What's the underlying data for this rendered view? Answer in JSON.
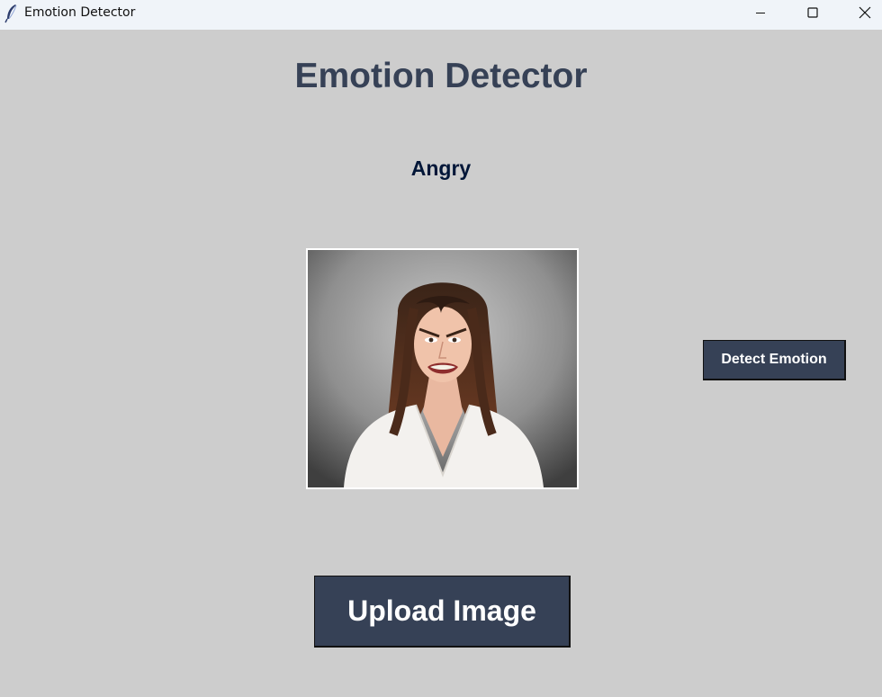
{
  "window": {
    "title": "Emotion Detector",
    "app_icon": "feather-icon",
    "controls": [
      "minimize-icon",
      "maximize-icon",
      "close-icon"
    ]
  },
  "main": {
    "heading": "Emotion Detector",
    "result_label": "Angry",
    "image_description": "uploaded-face-photo",
    "detect_button_label": "Detect Emotion",
    "upload_button_label": "Upload Image"
  },
  "colors": {
    "background": "#cdcdcd",
    "heading_text": "#364156",
    "result_text": "#011638",
    "button_bg": "#364156",
    "button_text": "#ffffff",
    "titlebar_bg": "#f0f4f9"
  }
}
